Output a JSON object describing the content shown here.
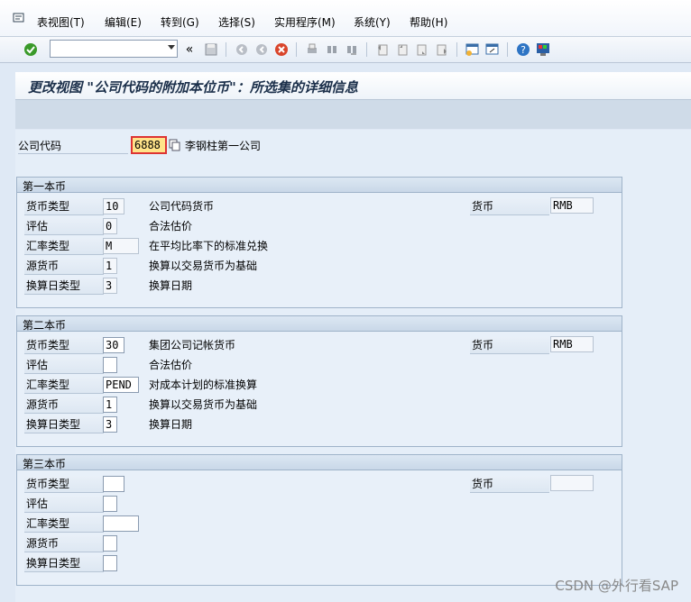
{
  "menu": {
    "items": [
      "表视图(T)",
      "编辑(E)",
      "转到(G)",
      "选择(S)",
      "实用程序(M)",
      "系统(Y)",
      "帮助(H)"
    ]
  },
  "toolbar": {
    "command_value": "",
    "icons": [
      "check-icon",
      "back-double-icon",
      "save-icon",
      "back-icon",
      "exit-icon",
      "cancel-icon",
      "print-icon",
      "find-icon",
      "find-next-icon",
      "first-page-icon",
      "prev-page-icon",
      "next-page-icon",
      "last-page-icon",
      "new-session-icon",
      "shortcut-icon",
      "help-icon",
      "customize-icon"
    ]
  },
  "title": "更改视图 \"公司代码的附加本位币\"：所选集的详细信息",
  "company": {
    "label": "公司代码",
    "code": "6888",
    "name": "李钢柱第一公司"
  },
  "groups": [
    {
      "title": "第一本币",
      "currency_type_label": "货币类型",
      "currency_type": "10",
      "currency_type_desc": "公司代码货币",
      "currency_label": "货币",
      "currency": "RMB",
      "valuation_label": "评估",
      "valuation": "0",
      "valuation_desc": "合法估价",
      "rate_label": "汇率类型",
      "rate": "M",
      "rate_desc": "在平均比率下的标准兑换",
      "source_label": "源货币",
      "source": "1",
      "source_desc": "换算以交易货币为基础",
      "date_label": "换算日类型",
      "date": "3",
      "date_desc": "换算日期"
    },
    {
      "title": "第二本币",
      "currency_type_label": "货币类型",
      "currency_type": "30",
      "currency_type_desc": "集团公司记帐货币",
      "currency_label": "货币",
      "currency": "RMB",
      "valuation_label": "评估",
      "valuation": "",
      "valuation_desc": "合法估价",
      "rate_label": "汇率类型",
      "rate": "PEND",
      "rate_desc": "对成本计划的标准换算",
      "source_label": "源货币",
      "source": "1",
      "source_desc": "换算以交易货币为基础",
      "date_label": "换算日类型",
      "date": "3",
      "date_desc": "换算日期"
    },
    {
      "title": "第三本币",
      "currency_type_label": "货币类型",
      "currency_type": "",
      "currency_type_desc": "",
      "currency_label": "货币",
      "currency": "",
      "valuation_label": "评估",
      "valuation": "",
      "valuation_desc": "",
      "rate_label": "汇率类型",
      "rate": "",
      "rate_desc": "",
      "source_label": "源货币",
      "source": "",
      "source_desc": "",
      "date_label": "换算日类型",
      "date": "",
      "date_desc": ""
    }
  ],
  "watermark": "CSDN @外行看SAP"
}
